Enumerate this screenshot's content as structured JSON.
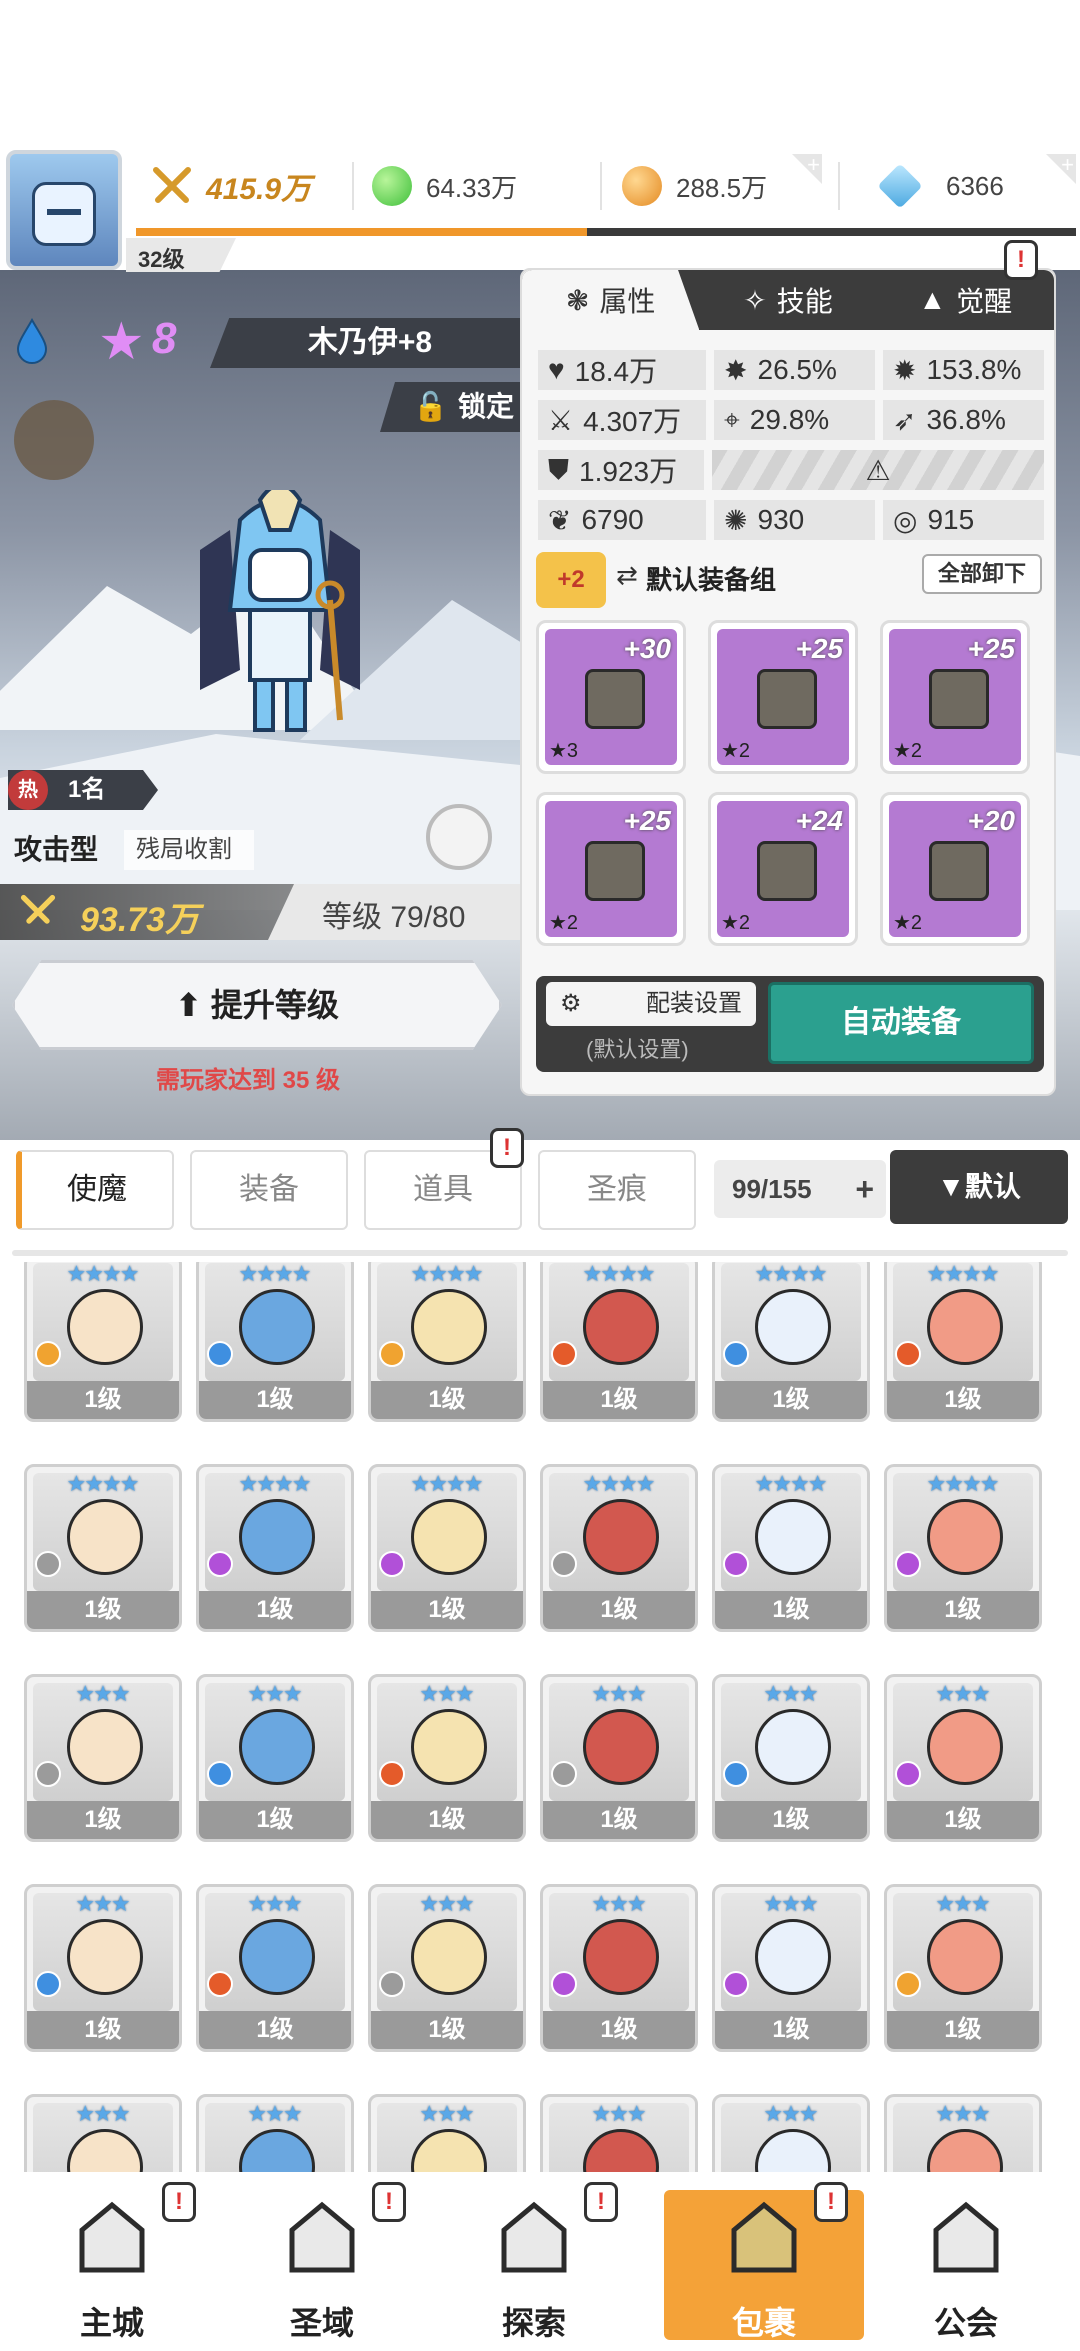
{
  "player": {
    "level_badge": "32级",
    "exp_fraction": 0.48
  },
  "currency": {
    "power": "415.9万",
    "green_gem": "64.33万",
    "gold": "288.5万",
    "diamond": "6366"
  },
  "hero": {
    "name": "木乃伊+8",
    "stars": "8",
    "lock": "锁定",
    "hot_badge": "热",
    "rank": "1名",
    "type": "攻击型",
    "skill": "残局收割",
    "power": "93.73万",
    "level": "等级 79/80",
    "upgrade_button": "提升等级",
    "upgrade_hint": "需玩家达到 35 级"
  },
  "panel": {
    "tabs": [
      "属性",
      "技能",
      "觉醒"
    ],
    "stats": {
      "hp": "18.4万",
      "crit": "26.5%",
      "crit_dmg": "153.8%",
      "atk": "4.307万",
      "acc": "29.8%",
      "dodge": "36.8%",
      "def": "1.923万",
      "s1": "6790",
      "s2": "930",
      "s3": "915"
    },
    "equip_badge": "+2",
    "equip_group": "默认装备组",
    "unequip_all": "全部卸下",
    "equipment": [
      {
        "plus": "+30",
        "rank": "★3",
        "color": "#b47ad2"
      },
      {
        "plus": "+25",
        "rank": "★2",
        "color": "#b47ad2"
      },
      {
        "plus": "+25",
        "rank": "★2",
        "color": "#b47ad2"
      },
      {
        "plus": "+25",
        "rank": "★2",
        "color": "#b47ad2"
      },
      {
        "plus": "+24",
        "rank": "★2",
        "color": "#b47ad2"
      },
      {
        "plus": "+20",
        "rank": "★2",
        "color": "#b47ad2"
      }
    ],
    "config_setting": "配装设置",
    "config_default": "(默认设置)",
    "auto_equip": "自动装备"
  },
  "inventory": {
    "tabs": [
      "使魔",
      "装备",
      "道具",
      "圣痕"
    ],
    "count": "99/155",
    "count_plus": "+",
    "sort": "▼默认",
    "cards": [
      {
        "stars": "★★★★",
        "level": "1级",
        "elem": "#f0a330"
      },
      {
        "stars": "★★★★",
        "level": "1级",
        "elem": "#3f8fe0"
      },
      {
        "stars": "★★★★",
        "level": "1级",
        "elem": "#f0a330"
      },
      {
        "stars": "★★★★",
        "level": "1级",
        "elem": "#e45b2a"
      },
      {
        "stars": "★★★★",
        "level": "1级",
        "elem": "#3f8fe0"
      },
      {
        "stars": "★★★★",
        "level": "1级",
        "elem": "#e45b2a"
      },
      {
        "stars": "★★★★",
        "level": "1级",
        "elem": "#9b9b9b"
      },
      {
        "stars": "★★★★",
        "level": "1级",
        "elem": "#b150d8"
      },
      {
        "stars": "★★★★",
        "level": "1级",
        "elem": "#b150d8"
      },
      {
        "stars": "★★★★",
        "level": "1级",
        "elem": "#9b9b9b"
      },
      {
        "stars": "★★★★",
        "level": "1级",
        "elem": "#b150d8"
      },
      {
        "stars": "★★★★",
        "level": "1级",
        "elem": "#b150d8"
      },
      {
        "stars": "★★★",
        "level": "1级",
        "elem": "#9b9b9b"
      },
      {
        "stars": "★★★",
        "level": "1级",
        "elem": "#3f8fe0"
      },
      {
        "stars": "★★★",
        "level": "1级",
        "elem": "#e45b2a"
      },
      {
        "stars": "★★★",
        "level": "1级",
        "elem": "#9b9b9b"
      },
      {
        "stars": "★★★",
        "level": "1级",
        "elem": "#3f8fe0"
      },
      {
        "stars": "★★★",
        "level": "1级",
        "elem": "#b150d8"
      },
      {
        "stars": "★★★",
        "level": "1级",
        "elem": "#3f8fe0"
      },
      {
        "stars": "★★★",
        "level": "1级",
        "elem": "#e45b2a"
      },
      {
        "stars": "★★★",
        "level": "1级",
        "elem": "#9b9b9b"
      },
      {
        "stars": "★★★",
        "level": "1级",
        "elem": "#b150d8"
      },
      {
        "stars": "★★★",
        "level": "1级",
        "elem": "#b150d8"
      },
      {
        "stars": "★★★",
        "level": "1级",
        "elem": "#f0a330"
      },
      {
        "stars": "★★★",
        "level": "",
        "elem": "#9b9b9b"
      },
      {
        "stars": "★★★",
        "level": "",
        "elem": "#9b9b9b"
      },
      {
        "stars": "★★★",
        "level": "",
        "elem": "#9b9b9b"
      },
      {
        "stars": "★★★",
        "level": "",
        "elem": "#9b9b9b"
      },
      {
        "stars": "★★★",
        "level": "",
        "elem": "#9b9b9b"
      },
      {
        "stars": "★★★",
        "level": "",
        "elem": "#9b9b9b"
      }
    ]
  },
  "nav": [
    {
      "label": "主城",
      "icon": "castle-icon"
    },
    {
      "label": "圣域",
      "icon": "vortex-icon"
    },
    {
      "label": "探索",
      "icon": "sword-stone-icon"
    },
    {
      "label": "包裹",
      "icon": "bag-icon"
    },
    {
      "label": "公会",
      "icon": "guild-icon"
    }
  ],
  "colors": {
    "accent": "#f4a238",
    "teal": "#2ba08f",
    "exp": "#f0972a"
  },
  "alert_mark": "!"
}
